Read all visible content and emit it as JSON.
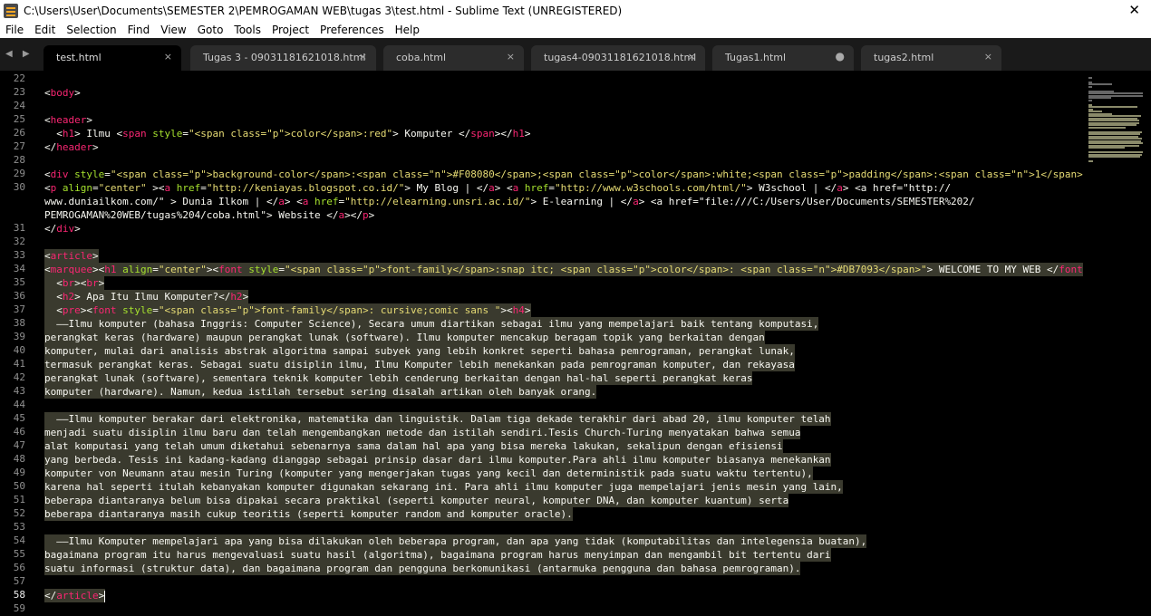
{
  "window": {
    "title": "C:\\Users\\User\\Documents\\SEMESTER 2\\PEMROGAMAN WEB\\tugas 3\\test.html - Sublime Text (UNREGISTERED)",
    "close_glyph": "✕"
  },
  "menu": [
    "File",
    "Edit",
    "Selection",
    "Find",
    "View",
    "Goto",
    "Tools",
    "Project",
    "Preferences",
    "Help"
  ],
  "tab_nav": "◀ ▶",
  "tabs": [
    {
      "label": "test.html",
      "active": true,
      "close": "×"
    },
    {
      "label": "Tugas 3 - 09031181621018.html",
      "active": false,
      "close": "×"
    },
    {
      "label": "coba.html",
      "active": false,
      "close": "×"
    },
    {
      "label": "tugas4-09031181621018.html",
      "active": false,
      "close": "×"
    },
    {
      "label": "Tugas1.html",
      "active": false,
      "close": "●"
    },
    {
      "label": "tugas2.html",
      "active": false,
      "close": "×"
    }
  ],
  "editor": {
    "current_line": "58",
    "line_numbers": [
      "22",
      "23",
      "24",
      "25",
      "26",
      "27",
      "28",
      "29",
      "30",
      "",
      "",
      "31",
      "32",
      "33",
      "34",
      "35",
      "36",
      "37",
      "38",
      "39",
      "40",
      "41",
      "42",
      "43",
      "44",
      "45",
      "46",
      "47",
      "48",
      "49",
      "50",
      "51",
      "52",
      "53",
      "54",
      "55",
      "56",
      "57",
      "58",
      "59"
    ],
    "lines": [
      "",
      "<body>",
      "",
      "<header>",
      "  <h1> Ilmu <span style=\"color:red\"> Komputer </span></h1>",
      "</header>",
      "",
      "<div style=\"background-color:#F08080;color:white;padding:1px \">",
      "<p align=\"center\" ><a href=\"http://keniayas.blogspot.co.id/\"> My Blog | </a> <a href=\"http://www.w3schools.com/html/\"> W3school | </a> <a href=\"http://",
      "www.duniailkom.com/\" > Dunia Ilkom | </a> <a href=\"http://elearning.unsri.ac.id/\"> E-learning | </a> <a href=\"file:///C:/Users/User/Documents/SEMESTER%202/",
      "PEMROGAMAN%20WEB/tugas%204/coba.html\"> Website </a></p>",
      "</div>",
      "",
      "<article>",
      "<marquee><h1 align=\"center\"><font style=\"font-family:snap itc; color: #DB7093\"> WELCOME TO MY WEB </font></h1></marquee>",
      "  <br><br>",
      "  <h2> Apa Itu Ilmu Komputer?</h2>",
      "  <pre><font style=\"font-family: cursive;comic sans \"><h4>",
      "  ——Ilmu komputer (bahasa Inggris: Computer Science), Secara umum diartikan sebagai ilmu yang mempelajari baik tentang komputasi,",
      "perangkat keras (hardware) maupun perangkat lunak (software). Ilmu komputer mencakup beragam topik yang berkaitan dengan",
      "komputer, mulai dari analisis abstrak algoritma sampai subyek yang lebih konkret seperti bahasa pemrograman, perangkat lunak,",
      "termasuk perangkat keras. Sebagai suatu disiplin ilmu, Ilmu Komputer lebih menekankan pada pemrograman komputer, dan rekayasa",
      "perangkat lunak (software), sementara teknik komputer lebih cenderung berkaitan dengan hal-hal seperti perangkat keras",
      "komputer (hardware). Namun, kedua istilah tersebut sering disalah artikan oleh banyak orang.",
      "",
      "  ——Ilmu komputer berakar dari elektronika, matematika dan linguistik. Dalam tiga dekade terakhir dari abad 20, ilmu komputer telah",
      "menjadi suatu disiplin ilmu baru dan telah mengembangkan metode dan istilah sendiri.Tesis Church-Turing menyatakan bahwa semua",
      "alat komputasi yang telah umum diketahui sebenarnya sama dalam hal apa yang bisa mereka lakukan, sekalipun dengan efisiensi",
      "yang berbeda. Tesis ini kadang-kadang dianggap sebagai prinsip dasar dari ilmu komputer.Para ahli ilmu komputer biasanya menekankan",
      "komputer von Neumann atau mesin Turing (komputer yang mengerjakan tugas yang kecil dan deterministik pada suatu waktu tertentu),",
      "karena hal seperti itulah kebanyakan komputer digunakan sekarang ini. Para ahli ilmu komputer juga mempelajari jenis mesin yang lain,",
      "beberapa diantaranya belum bisa dipakai secara praktikal (seperti komputer neural, komputer DNA, dan komputer kuantum) serta",
      "beberapa diantaranya masih cukup teoritis (seperti komputer random and komputer oracle).",
      "",
      "  ——Ilmu Komputer mempelajari apa yang bisa dilakukan oleh beberapa program, dan apa yang tidak (komputabilitas dan intelegensia buatan),",
      "bagaimana program itu harus mengevaluasi suatu hasil (algoritma), bagaimana program harus menyimpan dan mengambil bit tertentu dari",
      "suatu informasi (struktur data), dan bagaimana program dan pengguna berkomunikasi (antarmuka pengguna dan bahasa pemrograman).",
      "",
      "</article>",
      ""
    ],
    "selected_from": 13,
    "selected_to": 38
  },
  "colors": {
    "background": "#000000",
    "tag": "#f92672",
    "attribute": "#a6e22e",
    "string": "#e6db74",
    "property": "#66d9ef",
    "number": "#ae81ff",
    "selection": "#3a3a2e"
  }
}
